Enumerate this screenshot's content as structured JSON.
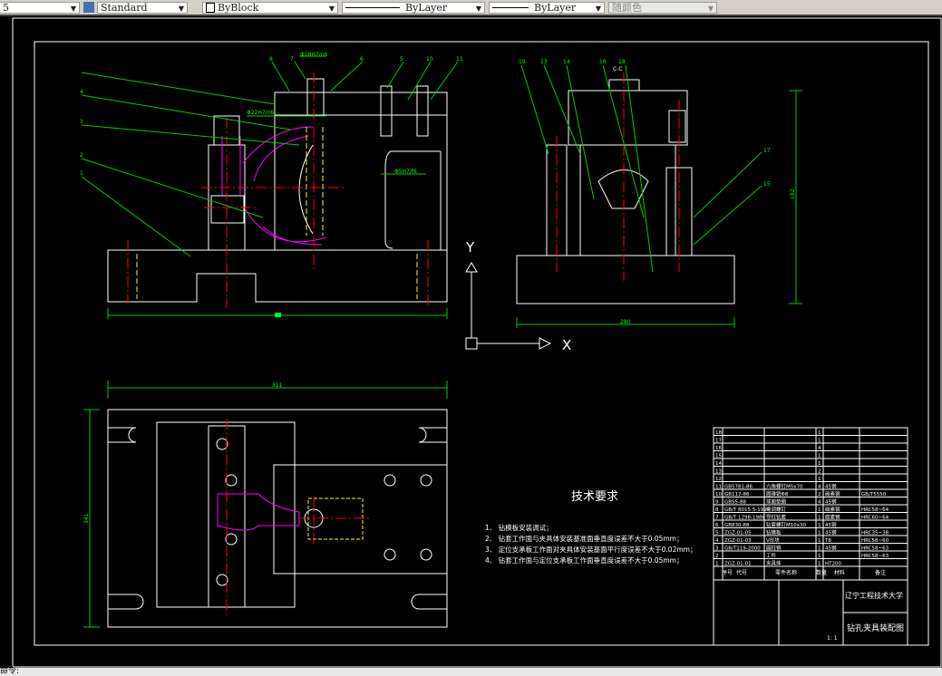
{
  "toolbar": {
    "text_style_prefix": "5",
    "text_style": "Standard",
    "color": "ByBlock",
    "linetype": "ByLayer",
    "lineweight": "ByLayer",
    "plot_style": "随颜色"
  },
  "drawing": {
    "section_label": "C-C",
    "front_view": {
      "fits": [
        "Φ18H7/n6",
        "Φ22H7/n6",
        "Φ5H7/f6"
      ],
      "leaders": [
        "8",
        "7",
        "6",
        "5",
        "10",
        "11",
        "4",
        "3",
        "2",
        "1"
      ]
    },
    "side_view": {
      "leaders": [
        "19",
        "13",
        "14",
        "16",
        "18",
        "17",
        "15"
      ],
      "dim_width": "280",
      "dim_height": "182"
    },
    "top_view": {
      "dim_width": "311",
      "dim_height": "341"
    },
    "ucs": {
      "x_label": "X",
      "y_label": "Y"
    }
  },
  "tech_requirements": {
    "title": "技术要求",
    "items": [
      "1、 钻模板安装调试；",
      "2、 钻套工作面与夹具体安装基准面垂直度误差不大于0.05mm；",
      "3、 定位支承板工作面对夹具体安装基面平行度误差不大于0.02mm；",
      "4、 钻套工作面与定位支承板工作面垂直度误差不大于0.05mm；"
    ]
  },
  "bom": {
    "rows": [
      {
        "no": "18",
        "code": "",
        "name": "",
        "qty": "1",
        "material": "",
        "note": ""
      },
      {
        "no": "17",
        "code": "",
        "name": "",
        "qty": "1",
        "material": "",
        "note": ""
      },
      {
        "no": "16",
        "code": "",
        "name": "",
        "qty": "4",
        "material": "",
        "note": ""
      },
      {
        "no": "15",
        "code": "",
        "name": "",
        "qty": "1",
        "material": "",
        "note": ""
      },
      {
        "no": "14",
        "code": "",
        "name": "",
        "qty": "1",
        "material": "",
        "note": ""
      },
      {
        "no": "13",
        "code": "",
        "name": "",
        "qty": "2",
        "material": "",
        "note": ""
      },
      {
        "no": "12",
        "code": "",
        "name": "",
        "qty": "1",
        "material": "",
        "note": ""
      },
      {
        "no": "11",
        "code": "GB5781-86",
        "name": "六角螺钉M5x70",
        "qty": "4",
        "material": "45钢",
        "note": ""
      },
      {
        "no": "10",
        "code": "GB117-86",
        "name": "圆锥销Φ8",
        "qty": "2",
        "material": "碳素钢",
        "note": "GB/T5550"
      },
      {
        "no": "9",
        "code": "GB55-88",
        "name": "球面垫圈",
        "qty": "4",
        "material": "45钢",
        "note": ""
      },
      {
        "no": "8",
        "code": "GB/T 8015.5-1999",
        "name": "可调螺钉",
        "qty": "1",
        "material": "碳素钢",
        "note": "HRC58~64"
      },
      {
        "no": "7",
        "code": "GB/T 1298-1986",
        "name": "导柱钻套",
        "qty": "1",
        "material": "碳素钢",
        "note": "HRC60~64"
      },
      {
        "no": "6",
        "code": "GB830-88",
        "name": "钻套螺钉M10x30",
        "qty": "1",
        "material": "45钢",
        "note": ""
      },
      {
        "no": "5",
        "code": "ZGZ-01-05",
        "name": "钻模板",
        "qty": "1",
        "material": "45钢",
        "note": "HRC35~38"
      },
      {
        "no": "4",
        "code": "ZGZ-01-03",
        "name": "V形块",
        "qty": "1",
        "material": "T8",
        "note": "HRC58~60"
      },
      {
        "no": "3",
        "code": "GB/T119-2000",
        "name": "圆柱销",
        "qty": "1",
        "material": "45钢",
        "note": "HRC58~63"
      },
      {
        "no": "2",
        "code": "",
        "name": "工件",
        "qty": "1",
        "material": "",
        "note": "HRC58~63"
      },
      {
        "no": "1",
        "code": "ZGZ-01-01",
        "name": "夹具体",
        "qty": "1",
        "material": "HT200",
        "note": ""
      }
    ],
    "headers": {
      "no": "序号",
      "code": "代号",
      "name": "零件名称",
      "qty": "数量",
      "material": "材料",
      "note": "备注"
    },
    "school": "辽宁工程技术大学",
    "drawing_title": "钻孔夹具装配图",
    "scale": "1:  1"
  },
  "status": {
    "prompt": "命令:"
  },
  "colors": {
    "background": "#000000",
    "outline": "#ffffff",
    "dimension": "#00ff00",
    "centerline": "#ff0000",
    "workpiece": "#ff00ff",
    "hidden": "#ffff00"
  }
}
